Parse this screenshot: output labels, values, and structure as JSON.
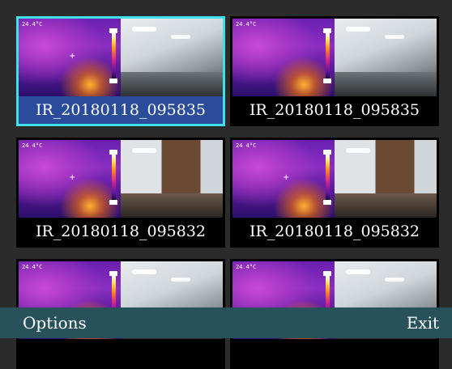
{
  "tiles": [
    {
      "label": "IR_20180118_095835",
      "selected": true,
      "scene": "hall"
    },
    {
      "label": "IR_20180118_095835",
      "selected": false,
      "scene": "hall"
    },
    {
      "label": "IR_20180118_095832",
      "selected": false,
      "scene": "door"
    },
    {
      "label": "IR_20180118_095832",
      "selected": false,
      "scene": "door"
    },
    {
      "label": "",
      "selected": false,
      "scene": "hall"
    },
    {
      "label": "",
      "selected": false,
      "scene": "hall"
    }
  ],
  "ir_temp": "24.4°C",
  "softkeys": {
    "left": "Options",
    "right": "Exit"
  },
  "colors": {
    "selection": "#3fe0e8",
    "caption_selected_bg": "#2a4c9a",
    "softkey_bar": "#27525c"
  }
}
